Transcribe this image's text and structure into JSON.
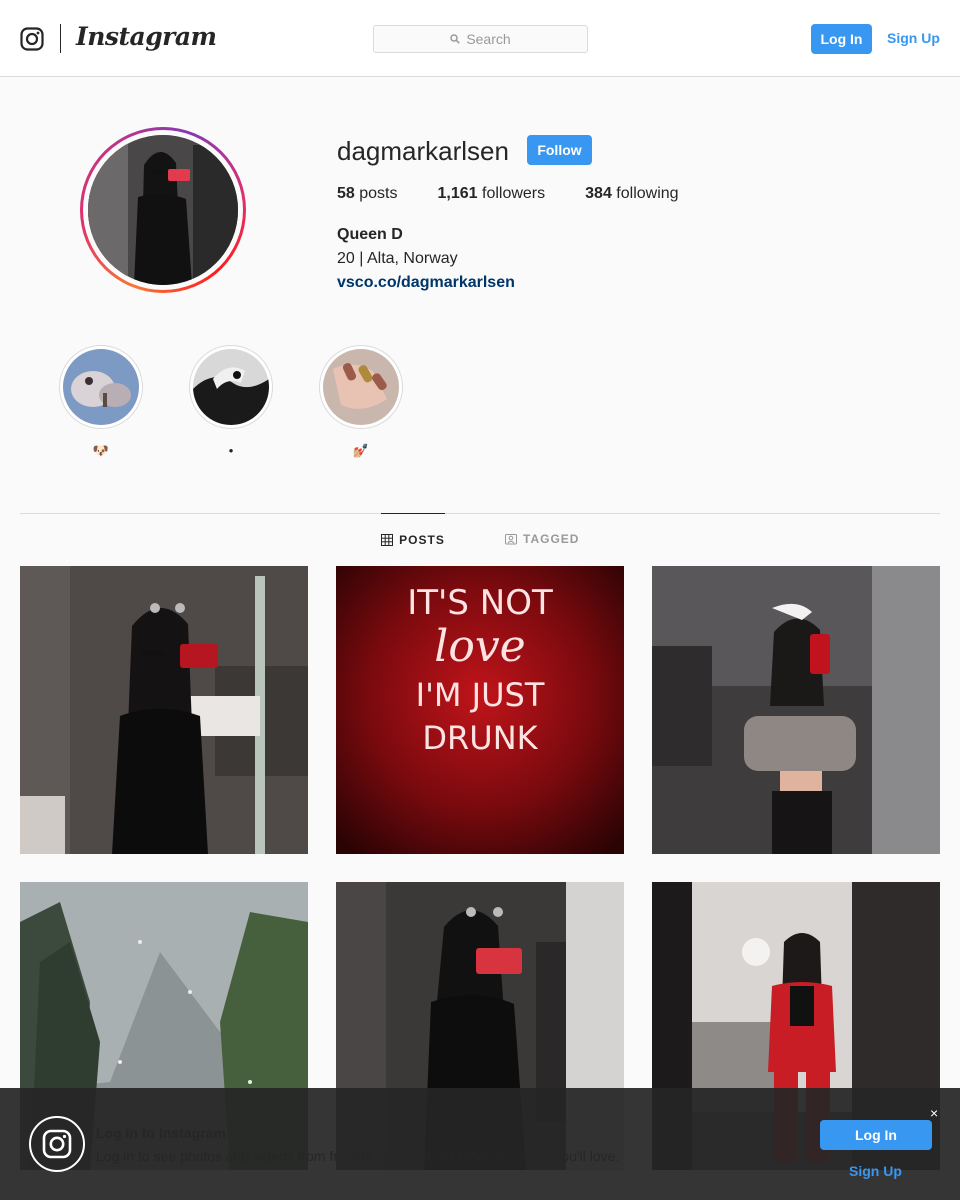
{
  "header": {
    "wordmark": "Instagram",
    "search_placeholder": "Search",
    "login_label": "Log In",
    "signup_label": "Sign Up"
  },
  "profile": {
    "username": "dagmarkarlsen",
    "follow_label": "Follow",
    "posts_count": "58",
    "posts_label": "posts",
    "followers_count": "1,161",
    "followers_label": "followers",
    "following_count": "384",
    "following_label": "following",
    "full_name": "Queen D",
    "bio": "20 | Alta, Norway",
    "website": "vsco.co/dagmarkarlsen"
  },
  "highlights": [
    {
      "label": "🐶"
    },
    {
      "label": "•"
    },
    {
      "label": "💅🏼"
    }
  ],
  "tabs": [
    {
      "label": "POSTS",
      "active": true,
      "icon": "grid-icon"
    },
    {
      "label": "TAGGED",
      "active": false,
      "icon": "tagged-icon"
    }
  ],
  "posts": [
    {
      "kind": "mirror-selfie-black-dress"
    },
    {
      "kind": "neon-sign",
      "lines": [
        "IT'S NOT",
        "love",
        "I'M JUST",
        "DRUNK"
      ]
    },
    {
      "kind": "mirror-selfie-crop-top"
    },
    {
      "kind": "rainy-window-trees"
    },
    {
      "kind": "mirror-selfie-back"
    },
    {
      "kind": "mirror-selfie-red-tracksuit"
    }
  ],
  "banner": {
    "title": "Log In to Instagram",
    "text": "Log in to see photos and videos from friends and discover other accounts you'll love.",
    "login_label": "Log In",
    "signup_label": "Sign Up",
    "close_label": "×"
  },
  "colors": {
    "accent": "#3897f0",
    "link": "#003569",
    "text": "#262626",
    "border": "#dbdbdb",
    "background": "#fafafa"
  }
}
